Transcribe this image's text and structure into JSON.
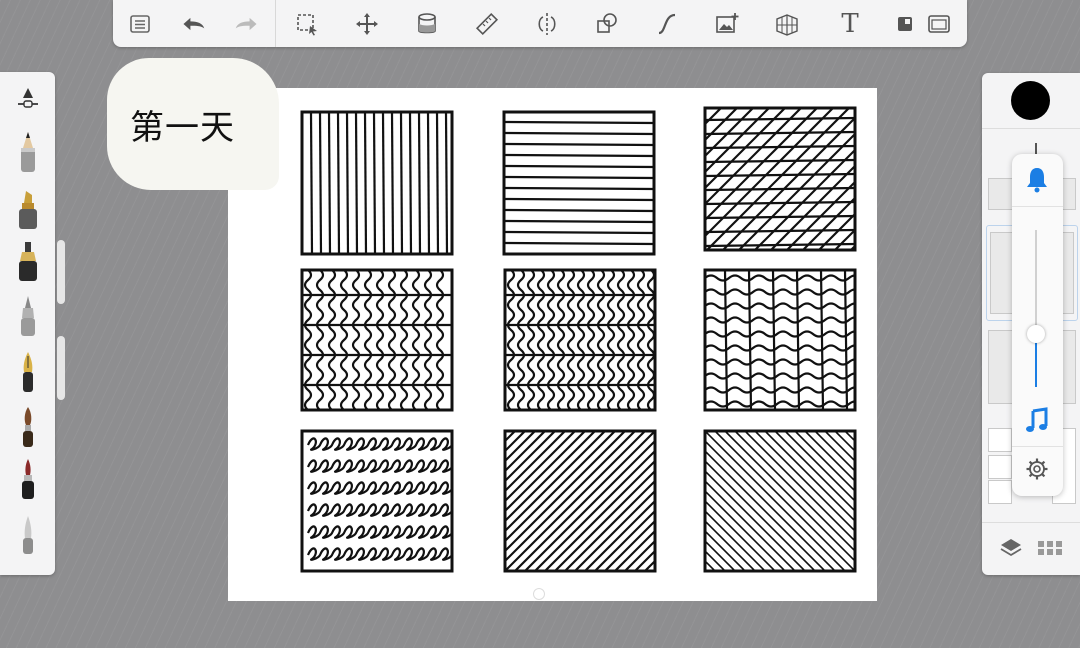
{
  "annotation": {
    "text": "第一天"
  },
  "toolbar": {
    "text_tool_label": "T",
    "icons": [
      "list-icon",
      "undo-icon",
      "redo-icon",
      "selection-icon",
      "move-icon",
      "fill-icon",
      "ruler-icon",
      "symmetry-icon",
      "shapes-icon",
      "curve-icon",
      "image-insert-icon",
      "perspective-icon",
      "text-icon",
      "layer-mode-icon",
      "fullscreen-icon"
    ]
  },
  "brushes": {
    "items": [
      "brush-size-icon",
      "pencil-icon",
      "marker-icon",
      "ink-pen-icon",
      "airbrush-icon",
      "fountain-pen-icon",
      "paintbrush-icon",
      "brush-pen-icon",
      "smudge-icon"
    ]
  },
  "colors": {
    "current": "#000000",
    "accent": "#1b7ee4",
    "canvas": "#ffffff",
    "workspace": "#8e8e90"
  },
  "popover": {
    "icons": [
      "bell-icon",
      "music-icon",
      "gear-icon"
    ],
    "slider_value": 0.33
  },
  "canvas_content": {
    "exercises": [
      "vertical-lines",
      "horizontal-lines",
      "crosshatch",
      "wavy-vertical",
      "wavy-vertical-dense",
      "wavy-grid",
      "loops",
      "diagonal-lines",
      "diagonal-lines-reverse"
    ]
  }
}
